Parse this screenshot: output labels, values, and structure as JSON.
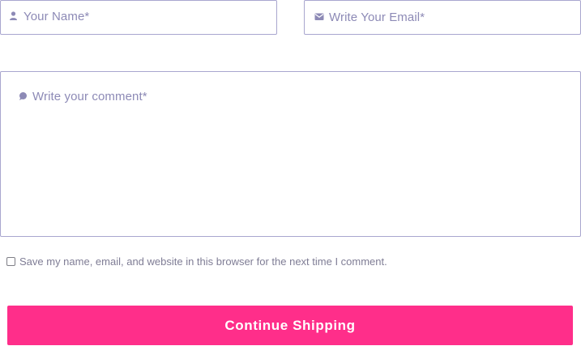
{
  "form": {
    "name": {
      "placeholder": "Your Name*",
      "icon": "user-icon"
    },
    "email": {
      "placeholder": "Write Your Email*",
      "icon": "envelope-icon"
    },
    "comment": {
      "placeholder": "Write your comment*",
      "icon": "speech-bubble-icon"
    },
    "save_consent": {
      "label": "Save my name, email, and website in this browser for the next time I comment.",
      "checked": false
    },
    "submit_label": "Continue Shipping"
  },
  "colors": {
    "border": "#a9a6cf",
    "placeholder": "#8d8ab6",
    "button": "#ff2e8a",
    "button_text": "#ffffff"
  }
}
